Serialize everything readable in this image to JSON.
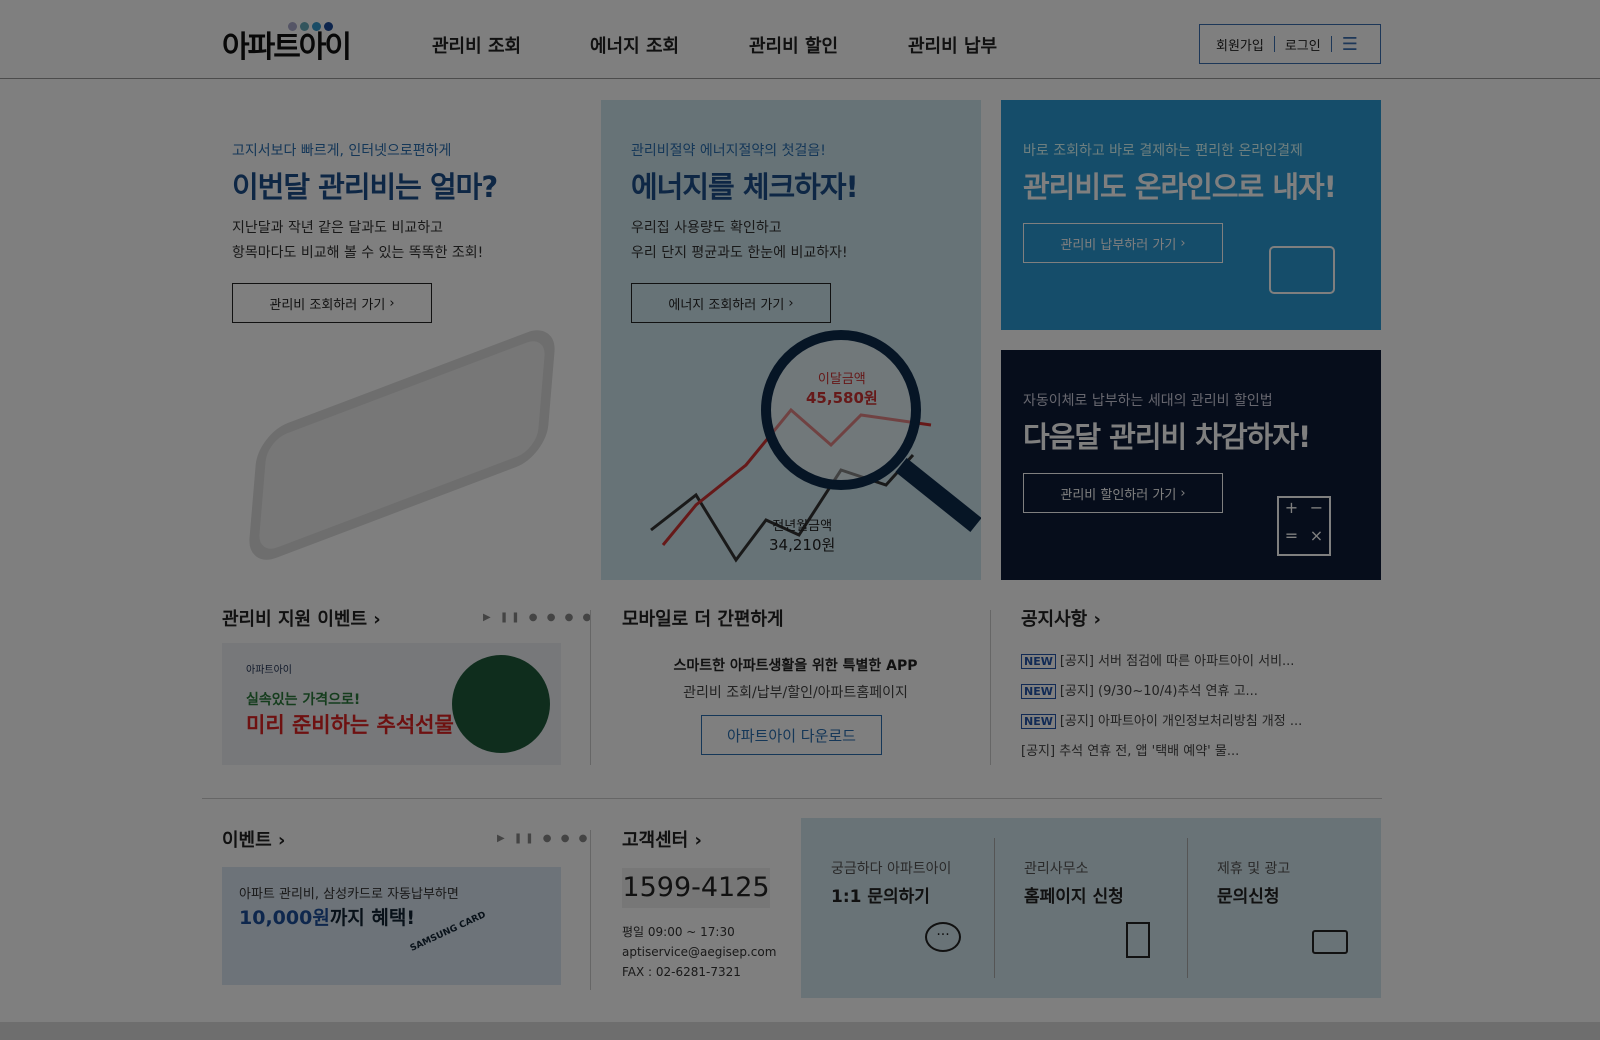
{
  "header": {
    "logo": "아파트아이",
    "nav": [
      "관리비 조회",
      "에너지 조회",
      "관리비 할인",
      "관리비 납부"
    ],
    "signup": "회원가입",
    "login": "로그인"
  },
  "cards": [
    {
      "sub": "고지서보다 빠르게, 인터넷으로편하게",
      "title": "이번달 관리비는 얼마?",
      "desc1": "지난달과 작년 같은 달과도 비교하고",
      "desc2": "항목마다도 비교해 볼 수 있는 똑똑한 조회!",
      "button": "관리비 조회하러 가기"
    },
    {
      "sub": "관리비절약 에너지절약의 첫걸음!",
      "title": "에너지를 체크하자!",
      "desc1": "우리집 사용량도 확인하고",
      "desc2": "우리 단지 평균과도 한눈에 비교하자!",
      "button": "에너지 조회하러 가기",
      "this_label": "이달금액",
      "this_value": "45,580원",
      "last_label": "전년월금액",
      "last_value": "34,210원"
    },
    {
      "sub": "바로 조회하고 바로 결제하는 편리한 온라인결제",
      "title": "관리비도 온라인으로 내자!",
      "button": "관리비 납부하러 가기"
    },
    {
      "sub": "자동이체로 납부하는 세대의 관리비 할인법",
      "title": "다음달 관리비 차감하자!",
      "button": "관리비 할인하러 가기"
    }
  ],
  "support_event": {
    "title": "관리비 지원 이벤트",
    "banner_brand": "아파트아이",
    "banner_line1": "실속있는 가격으로!",
    "banner_line2": "미리 준비하는 추석선물"
  },
  "mobile": {
    "title": "모바일로 더 간편하게",
    "line1": "스마트한 아파트생활을 위한 특별한 APP",
    "line2": "관리비 조회/납부/할인/아파트홈페이지",
    "button": "아파트아이 다운로드"
  },
  "notices": {
    "title": "공지사항",
    "badge": "NEW",
    "items": [
      {
        "text": "[공지] 서버 점검에 따른 아파트아이 서비...",
        "new": true
      },
      {
        "text": "[공지] (9/30~10/4)추석 연휴 고...",
        "new": true
      },
      {
        "text": "[공지] 아파트아이 개인정보처리방침 개정 ...",
        "new": true
      },
      {
        "text": "[공지] 추석 연휴 전, 앱 '택배 예약' 물...",
        "new": false
      }
    ]
  },
  "event": {
    "title": "이벤트",
    "banner_line1": "아파트 관리비, 삼성카드로 자동납부하면",
    "banner_amount": "10,000원",
    "banner_rest": "까지 혜택!",
    "banner_card": "SAMSUNG CARD"
  },
  "cs": {
    "title": "고객센터",
    "phone": "1599-4125",
    "hours": "평일 09:00 ~ 17:30",
    "email": "aptiservice@aegisep.com",
    "fax": "FAX : 02-6281-7321"
  },
  "quick": [
    {
      "sub": "궁금하다 아파트아이",
      "title": "1:1 문의하기"
    },
    {
      "sub": "관리사무소",
      "title": "홈페이지 신청"
    },
    {
      "sub": "제휴 및 광고",
      "title": "문의신청"
    }
  ]
}
